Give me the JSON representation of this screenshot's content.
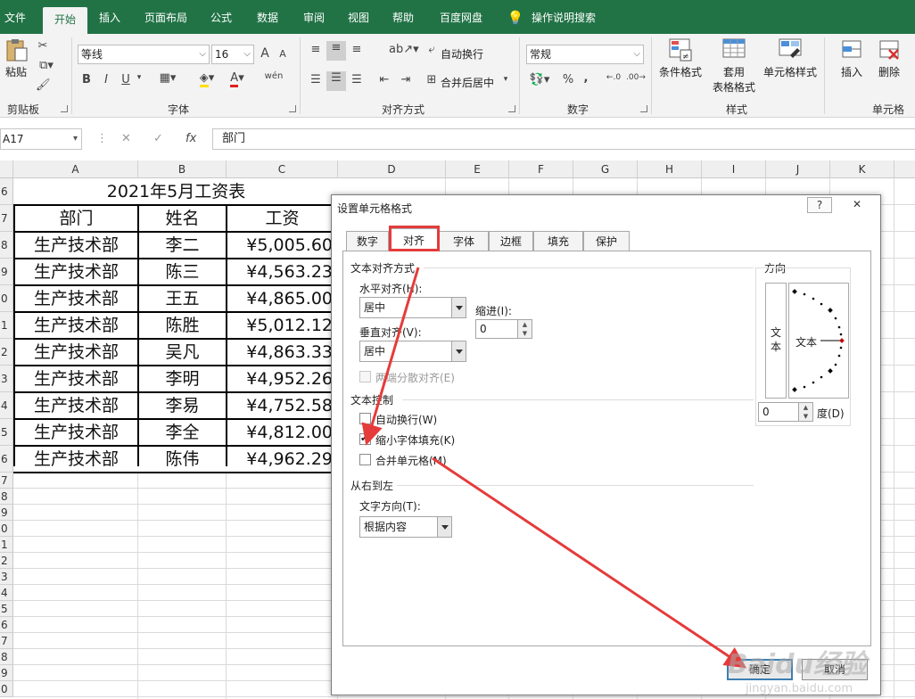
{
  "ribbon": {
    "tabs": [
      "文件",
      "开始",
      "插入",
      "页面布局",
      "公式",
      "数据",
      "审阅",
      "视图",
      "帮助",
      "百度网盘",
      "操作说明搜索"
    ],
    "active_tab": "开始",
    "clipboard": {
      "paste": "粘贴",
      "group": "剪贴板"
    },
    "font": {
      "name": "等线",
      "size": "16",
      "bold": "B",
      "italic": "I",
      "underline": "U",
      "grow": "A",
      "shrink": "A",
      "phonetic": "wén",
      "group": "字体"
    },
    "alignment": {
      "wrap": "自动换行",
      "merge": "合并后居中",
      "group": "对齐方式"
    },
    "number": {
      "format": "常规",
      "percent": "%",
      "comma": ",",
      "group": "数字"
    },
    "styles": {
      "conditional": "条件格式",
      "table_format_1": "套用",
      "table_format_2": "表格格式",
      "cell_styles": "单元格样式",
      "group": "样式"
    },
    "cells": {
      "insert": "插入",
      "delete": "删除",
      "group": "单元格"
    },
    "accent_color": "#217346"
  },
  "formula_bar": {
    "name_box": "A17",
    "cancel": "✕",
    "enter": "✓",
    "fx": "fx",
    "content": "部门"
  },
  "grid": {
    "columns": [
      "A",
      "B",
      "C",
      "D",
      "E",
      "F",
      "G",
      "H",
      "I",
      "J",
      "K"
    ],
    "rows": [
      "6",
      "7",
      "8",
      "9",
      "0",
      "1",
      "2",
      "3",
      "4",
      "5",
      "6",
      "7",
      "8",
      "9",
      "0",
      "1",
      "2",
      "3",
      "4",
      "5",
      "6",
      "7",
      "8",
      "9",
      "0"
    ],
    "title": "2021年5月工资表",
    "headers": [
      "部门",
      "姓名",
      "工资"
    ],
    "records": [
      [
        "生产技术部",
        "李二",
        "¥5,005.60"
      ],
      [
        "生产技术部",
        "陈三",
        "¥4,563.23"
      ],
      [
        "生产技术部",
        "王五",
        "¥4,865.00"
      ],
      [
        "生产技术部",
        "陈胜",
        "¥5,012.12"
      ],
      [
        "生产技术部",
        "吴凡",
        "¥4,863.33"
      ],
      [
        "生产技术部",
        "李明",
        "¥4,952.26"
      ],
      [
        "生产技术部",
        "李易",
        "¥4,752.58"
      ],
      [
        "生产技术部",
        "李全",
        "¥4,812.00"
      ],
      [
        "生产技术部",
        "陈伟",
        "¥4,962.29"
      ]
    ]
  },
  "dialog": {
    "title": "设置单元格格式",
    "help": "?",
    "close": "✕",
    "tabs": [
      "数字",
      "对齐",
      "字体",
      "边框",
      "填充",
      "保护"
    ],
    "active_tab": "对齐",
    "text_alignment": {
      "section": "文本对齐方式",
      "horizontal_label": "水平对齐(H):",
      "horizontal_value": "居中",
      "indent_label": "缩进(I):",
      "indent_value": "0",
      "vertical_label": "垂直对齐(V):",
      "vertical_value": "居中",
      "distributed_label": "两端分散对齐(E)"
    },
    "text_control": {
      "section": "文本控制",
      "wrap_label": "自动换行(W)",
      "wrap_checked": false,
      "shrink_label": "缩小字体填充(K)",
      "shrink_checked": true,
      "merge_label": "合并单元格(M)",
      "merge_checked": false
    },
    "rtl": {
      "section": "从右到左",
      "direction_label": "文字方向(T):",
      "direction_value": "根据内容"
    },
    "orientation": {
      "section": "方向",
      "vertical_text_1": "文",
      "vertical_text_2": "本",
      "dial_text": "文本",
      "degrees_value": "0",
      "degrees_label": "度(D)"
    },
    "ok": "确定",
    "cancel": "取消"
  },
  "annotation": {
    "color": "#e53b3b"
  },
  "watermark": {
    "logo": "Baidu经验",
    "url": "jingyan.baidu.com"
  }
}
